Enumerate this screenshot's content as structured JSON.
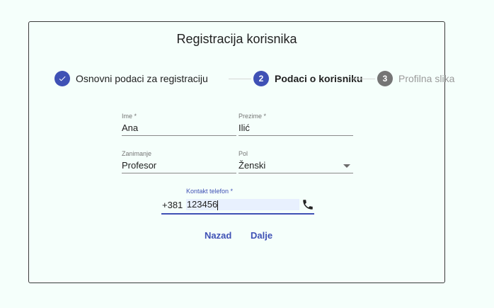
{
  "form": {
    "title": "Registracija korisnika"
  },
  "stepper": {
    "steps": [
      {
        "label": "Osnovni podaci za registraciju",
        "number": "1",
        "state": "done"
      },
      {
        "label": "Podaci o korisniku",
        "number": "2",
        "state": "active"
      },
      {
        "label": "Profilna slika",
        "number": "3",
        "state": "todo"
      }
    ]
  },
  "fields": {
    "ime": {
      "label": "Ime *",
      "value": "Ana"
    },
    "prezime": {
      "label": "Prezime *",
      "value": "Ilić"
    },
    "zanimanje": {
      "label": "Zanimanje",
      "value": "Profesor"
    },
    "pol": {
      "label": "Pol",
      "value": "Ženski"
    },
    "telefon": {
      "label": "Kontakt telefon *",
      "prefix": "+381",
      "value": "123456"
    }
  },
  "buttons": {
    "back": "Nazad",
    "next": "Dalje"
  },
  "colors": {
    "primary": "#3f51b5",
    "inactive_step": "#757575",
    "background": "#f5fffb"
  },
  "icons": {
    "done_step": "check-icon",
    "phone": "phone-icon",
    "dropdown": "chevron-down-icon"
  }
}
